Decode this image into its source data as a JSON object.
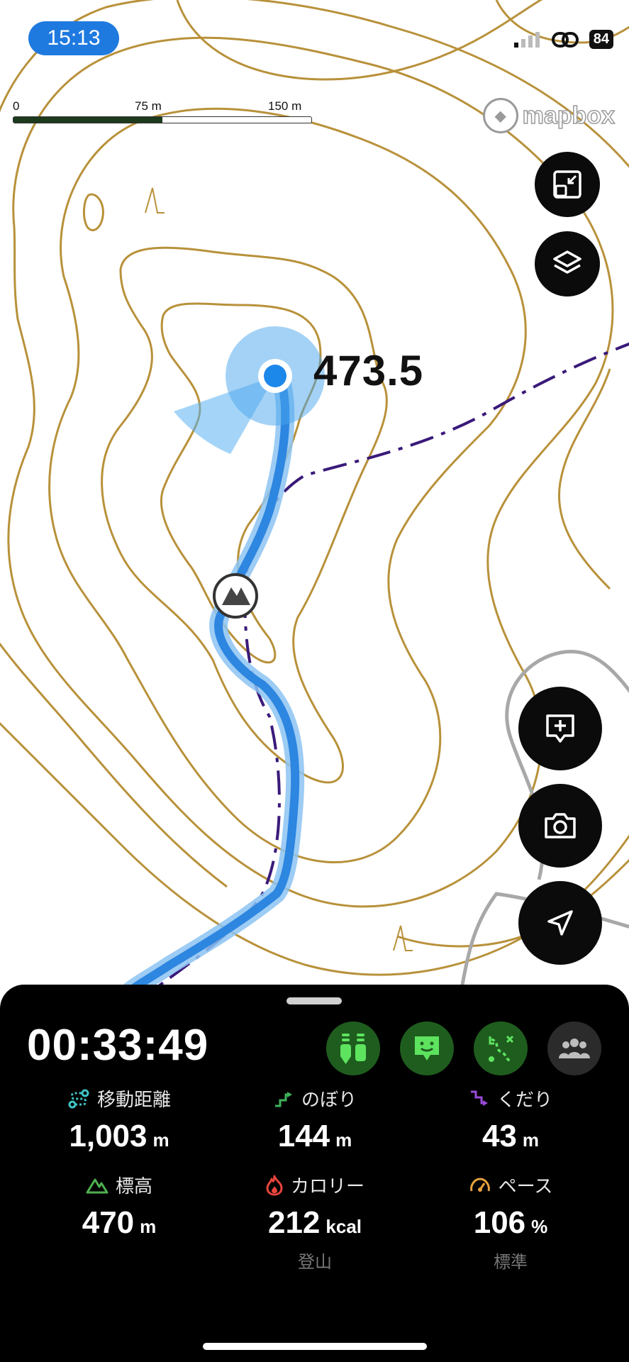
{
  "status_bar": {
    "time": "15:13",
    "battery": "84"
  },
  "map": {
    "scale": {
      "labels": [
        "0",
        "75 m",
        "150 m"
      ]
    },
    "attribution": "mapbox",
    "summit_elevation": "473.5",
    "colors": {
      "contour": "#b8913a",
      "track": "#2d86e0",
      "trail": "#3a1a7a",
      "road": "#a8a8a8"
    },
    "controls": [
      "shrink-icon",
      "layers-icon",
      "add-note-icon",
      "camera-icon",
      "locate-arrow-icon"
    ]
  },
  "panel": {
    "elapsed": "00:33:49",
    "chips": [
      "hikers-icon",
      "face-icon",
      "route-icon",
      "group-icon"
    ],
    "stats": [
      {
        "label": "移動距離",
        "value": "1,003",
        "unit": "m",
        "icon": "distance-icon",
        "color": "#40c4c4"
      },
      {
        "label": "のぼり",
        "value": "144",
        "unit": "m",
        "icon": "ascent-icon",
        "color": "#3fb35a"
      },
      {
        "label": "くだり",
        "value": "43",
        "unit": "m",
        "icon": "descent-icon",
        "color": "#9b4bd9"
      },
      {
        "label": "標高",
        "value": "470",
        "unit": "m",
        "icon": "mountain-icon",
        "color": "#4fb04f"
      },
      {
        "label": "カロリー",
        "value": "212",
        "unit": "kcal",
        "sub": "登山",
        "icon": "flame-icon",
        "color": "#e8453c"
      },
      {
        "label": "ペース",
        "value": "106",
        "unit": "%",
        "sub": "標準",
        "icon": "speedometer-icon",
        "color": "#e8a33c"
      }
    ]
  }
}
